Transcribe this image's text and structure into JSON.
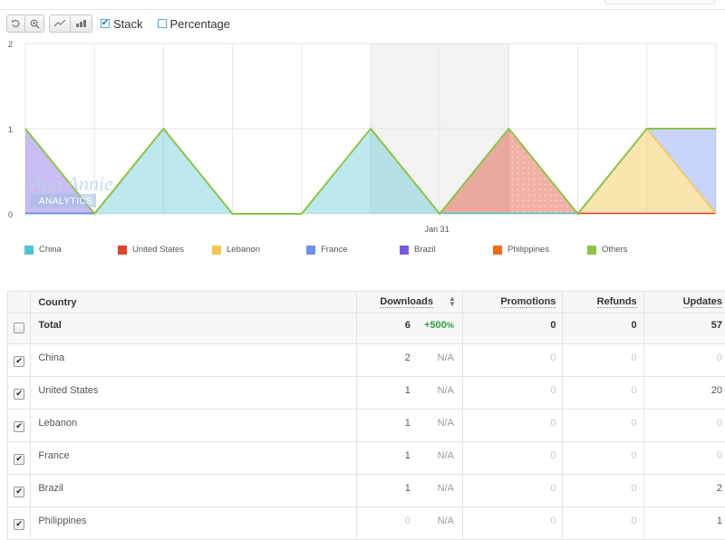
{
  "toolbar": {
    "reset_icon": "undo-icon",
    "zoom_icon": "zoom-icon",
    "line_icon": "line-chart-icon",
    "bar_icon": "bar-chart-icon",
    "stack_label": "Stack",
    "stack_checked": true,
    "percentage_label": "Percentage",
    "percentage_checked": false
  },
  "watermark": {
    "brand": "App Annie",
    "sub": "ANALYTICS"
  },
  "chart_data": {
    "type": "area",
    "stacked": true,
    "x_tick_labels": [
      "Jan 31"
    ],
    "y_tick_labels": [
      "2",
      "1",
      "0"
    ],
    "ylim": [
      0,
      2
    ],
    "highlighted_period": "Jan 31",
    "series": [
      {
        "name": "China",
        "color": "#4fc3d2",
        "values": [
          0,
          0,
          1,
          0,
          0,
          1,
          0,
          0,
          0,
          0
        ]
      },
      {
        "name": "United States",
        "color": "#e0452a",
        "values": [
          0,
          0,
          0,
          0,
          0,
          0,
          0,
          1,
          0,
          0
        ]
      },
      {
        "name": "Lebanon",
        "color": "#f6c653",
        "values": [
          0,
          0,
          0,
          0,
          0,
          0,
          0,
          0,
          0,
          1
        ]
      },
      {
        "name": "France",
        "color": "#6f8ff0",
        "values": [
          0,
          0,
          0,
          0,
          0,
          0,
          0,
          0,
          0,
          0
        ]
      },
      {
        "name": "Brazil",
        "color": "#7a5ae0",
        "values": [
          1,
          0,
          0,
          0,
          0,
          0,
          0,
          0,
          0,
          0
        ]
      },
      {
        "name": "Philippines",
        "color": "#f06a18",
        "values": [
          0,
          0,
          0,
          0,
          0,
          0,
          0,
          0,
          0,
          0
        ]
      },
      {
        "name": "Others",
        "color": "#8ec24b",
        "values": [
          1,
          0,
          1,
          0,
          0,
          1,
          0,
          1,
          0,
          1
        ]
      }
    ],
    "last_point_extra": {
      "France": 1
    }
  },
  "legend": [
    {
      "name": "China",
      "color": "#4fc3d2"
    },
    {
      "name": "United States",
      "color": "#e0452a"
    },
    {
      "name": "Lebanon",
      "color": "#f6c653"
    },
    {
      "name": "France",
      "color": "#6f8ff0"
    },
    {
      "name": "Brazil",
      "color": "#7a5ae0"
    },
    {
      "name": "Philippines",
      "color": "#f06a18"
    },
    {
      "name": "Others",
      "color": "#8ec24b"
    }
  ],
  "table": {
    "headers": {
      "country": "Country",
      "downloads": "Downloads",
      "promotions": "Promotions",
      "refunds": "Refunds",
      "updates": "Updates"
    },
    "total": {
      "label": "Total",
      "downloads": "6",
      "change": "+500",
      "change_unit": "%",
      "promotions": "0",
      "refunds": "0",
      "updates": "57"
    },
    "rows": [
      {
        "country": "China",
        "downloads": "2",
        "change": "N/A",
        "promotions": "0",
        "refunds": "0",
        "updates": "0"
      },
      {
        "country": "United States",
        "downloads": "1",
        "change": "N/A",
        "promotions": "0",
        "refunds": "0",
        "updates": "20"
      },
      {
        "country": "Lebanon",
        "downloads": "1",
        "change": "N/A",
        "promotions": "0",
        "refunds": "0",
        "updates": "0"
      },
      {
        "country": "France",
        "downloads": "1",
        "change": "N/A",
        "promotions": "0",
        "refunds": "0",
        "updates": "0"
      },
      {
        "country": "Brazil",
        "downloads": "1",
        "change": "N/A",
        "promotions": "0",
        "refunds": "0",
        "updates": "2"
      },
      {
        "country": "Philippines",
        "downloads": "0",
        "change": "N/A",
        "promotions": "0",
        "refunds": "0",
        "updates": "1"
      }
    ]
  }
}
